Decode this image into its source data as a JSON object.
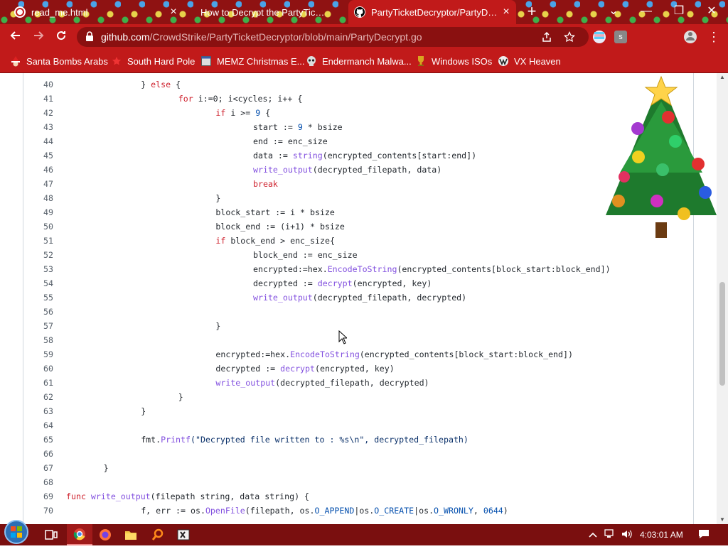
{
  "browser": {
    "tabs": [
      {
        "title": "read_me.html",
        "icon": "html-file-icon"
      },
      {
        "title": "How to Decrypt the PartyTicket R",
        "icon": "page-icon"
      },
      {
        "title": "PartyTicketDecryptor/PartyDecry",
        "icon": "github-icon"
      }
    ],
    "window_controls": {
      "dropdown": "⌄",
      "minimize": "—",
      "restore": "❐",
      "close": "✕"
    },
    "url": {
      "host": "github.com",
      "path": "/CrowdStrike/PartyTicketDecryptor/blob/main/PartyDecrypt.go"
    },
    "bookmarks": [
      {
        "label": "Santa Bombs Arabs",
        "icon": "santa-icon"
      },
      {
        "label": "South Hard Pole",
        "icon": "star-icon"
      },
      {
        "label": "MEMZ Christmas E...",
        "icon": "window-icon"
      },
      {
        "label": "Endermanch Malwa...",
        "icon": "skull-icon"
      },
      {
        "label": "Windows ISOs",
        "icon": "trophy-icon"
      },
      {
        "label": "VX Heaven",
        "icon": "vx-icon"
      }
    ]
  },
  "code": {
    "lines": [
      {
        "n": "40",
        "indent": 2,
        "tokens": [
          {
            "t": "} ",
            "c": "p"
          },
          {
            "t": "else",
            "c": "kw"
          },
          {
            "t": " {",
            "c": "p"
          }
        ]
      },
      {
        "n": "41",
        "indent": 3,
        "tokens": [
          {
            "t": "for",
            "c": "kw"
          },
          {
            "t": " i:=0; i<cycles; i++ {",
            "c": "p"
          }
        ]
      },
      {
        "n": "42",
        "indent": 4,
        "tokens": [
          {
            "t": "if",
            "c": "kw"
          },
          {
            "t": " i >= ",
            "c": "p"
          },
          {
            "t": "9",
            "c": "num"
          },
          {
            "t": " {",
            "c": "p"
          }
        ]
      },
      {
        "n": "43",
        "indent": 5,
        "tokens": [
          {
            "t": "start := ",
            "c": "p"
          },
          {
            "t": "9",
            "c": "num"
          },
          {
            "t": " * bsize",
            "c": "p"
          }
        ]
      },
      {
        "n": "44",
        "indent": 5,
        "tokens": [
          {
            "t": "end := enc_size",
            "c": "p"
          }
        ]
      },
      {
        "n": "45",
        "indent": 5,
        "tokens": [
          {
            "t": "data := ",
            "c": "p"
          },
          {
            "t": "string",
            "c": "fn"
          },
          {
            "t": "(encrypted_contents[start:end])",
            "c": "p"
          }
        ]
      },
      {
        "n": "46",
        "indent": 5,
        "tokens": [
          {
            "t": "write_output",
            "c": "fn"
          },
          {
            "t": "(decrypted_filepath, data)",
            "c": "p"
          }
        ]
      },
      {
        "n": "47",
        "indent": 5,
        "tokens": [
          {
            "t": "break",
            "c": "kw"
          }
        ]
      },
      {
        "n": "48",
        "indent": 4,
        "tokens": [
          {
            "t": "}",
            "c": "p"
          }
        ]
      },
      {
        "n": "49",
        "indent": 4,
        "tokens": [
          {
            "t": "block_start := i * bsize",
            "c": "p"
          }
        ]
      },
      {
        "n": "50",
        "indent": 4,
        "tokens": [
          {
            "t": "block_end := (i+1) * bsize",
            "c": "p"
          }
        ]
      },
      {
        "n": "51",
        "indent": 4,
        "tokens": [
          {
            "t": "if",
            "c": "kw"
          },
          {
            "t": " block_end > enc_size{",
            "c": "p"
          }
        ]
      },
      {
        "n": "52",
        "indent": 5,
        "tokens": [
          {
            "t": "block_end := enc_size",
            "c": "p"
          }
        ]
      },
      {
        "n": "53",
        "indent": 5,
        "tokens": [
          {
            "t": "encrypted:=hex.",
            "c": "p"
          },
          {
            "t": "EncodeToString",
            "c": "fn"
          },
          {
            "t": "(encrypted_contents[block_start:block_end])",
            "c": "p"
          }
        ]
      },
      {
        "n": "54",
        "indent": 5,
        "tokens": [
          {
            "t": "decrypted := ",
            "c": "p"
          },
          {
            "t": "decrypt",
            "c": "fn"
          },
          {
            "t": "(encrypted, key)",
            "c": "p"
          }
        ]
      },
      {
        "n": "55",
        "indent": 5,
        "tokens": [
          {
            "t": "write_output",
            "c": "fn"
          },
          {
            "t": "(decrypted_filepath, decrypted)",
            "c": "p"
          }
        ]
      },
      {
        "n": "56",
        "indent": 0,
        "tokens": []
      },
      {
        "n": "57",
        "indent": 4,
        "tokens": [
          {
            "t": "}",
            "c": "p"
          }
        ]
      },
      {
        "n": "58",
        "indent": 0,
        "tokens": []
      },
      {
        "n": "59",
        "indent": 4,
        "tokens": [
          {
            "t": "encrypted:=hex.",
            "c": "p"
          },
          {
            "t": "EncodeToString",
            "c": "fn"
          },
          {
            "t": "(encrypted_contents[block_start:block_end])",
            "c": "p"
          }
        ]
      },
      {
        "n": "60",
        "indent": 4,
        "tokens": [
          {
            "t": "decrypted := ",
            "c": "p"
          },
          {
            "t": "decrypt",
            "c": "fn"
          },
          {
            "t": "(encrypted, key)",
            "c": "p"
          }
        ]
      },
      {
        "n": "61",
        "indent": 4,
        "tokens": [
          {
            "t": "write_output",
            "c": "fn"
          },
          {
            "t": "(decrypted_filepath, decrypted)",
            "c": "p"
          }
        ]
      },
      {
        "n": "62",
        "indent": 3,
        "tokens": [
          {
            "t": "}",
            "c": "p"
          }
        ]
      },
      {
        "n": "63",
        "indent": 2,
        "tokens": [
          {
            "t": "}",
            "c": "p"
          }
        ]
      },
      {
        "n": "64",
        "indent": 0,
        "tokens": []
      },
      {
        "n": "65",
        "indent": 2,
        "tokens": [
          {
            "t": "fmt.",
            "c": "p"
          },
          {
            "t": "Printf",
            "c": "fn"
          },
          {
            "t": "(\"Decrypted file written to : %s\\n\", decrypted_filepath)",
            "c": "str"
          }
        ]
      },
      {
        "n": "66",
        "indent": 0,
        "tokens": []
      },
      {
        "n": "67",
        "indent": 1,
        "tokens": [
          {
            "t": "}",
            "c": "p"
          }
        ]
      },
      {
        "n": "68",
        "indent": 0,
        "tokens": []
      },
      {
        "n": "69",
        "indent": 0,
        "tokens": [
          {
            "t": "func",
            "c": "kw"
          },
          {
            "t": " ",
            "c": "p"
          },
          {
            "t": "write_output",
            "c": "fn"
          },
          {
            "t": "(filepath string, data string) {",
            "c": "p"
          }
        ]
      },
      {
        "n": "70",
        "indent": 2,
        "tokens": [
          {
            "t": "f, err := os.",
            "c": "p"
          },
          {
            "t": "OpenFile",
            "c": "fn"
          },
          {
            "t": "(filepath, os.",
            "c": "p"
          },
          {
            "t": "O_APPEND",
            "c": "num"
          },
          {
            "t": "|os.",
            "c": "p"
          },
          {
            "t": "O_CREATE",
            "c": "num"
          },
          {
            "t": "|os.",
            "c": "p"
          },
          {
            "t": "O_WRONLY",
            "c": "num"
          },
          {
            "t": ", ",
            "c": "p"
          },
          {
            "t": "0644",
            "c": "num"
          },
          {
            "t": ")",
            "c": "p"
          }
        ]
      }
    ]
  },
  "taskbar": {
    "clock": "4:03:01 AM",
    "apps": [
      "explorer-view-icon",
      "chrome-icon",
      "firefox-icon",
      "folder-icon",
      "search-tool-icon",
      "excel-icon"
    ]
  }
}
